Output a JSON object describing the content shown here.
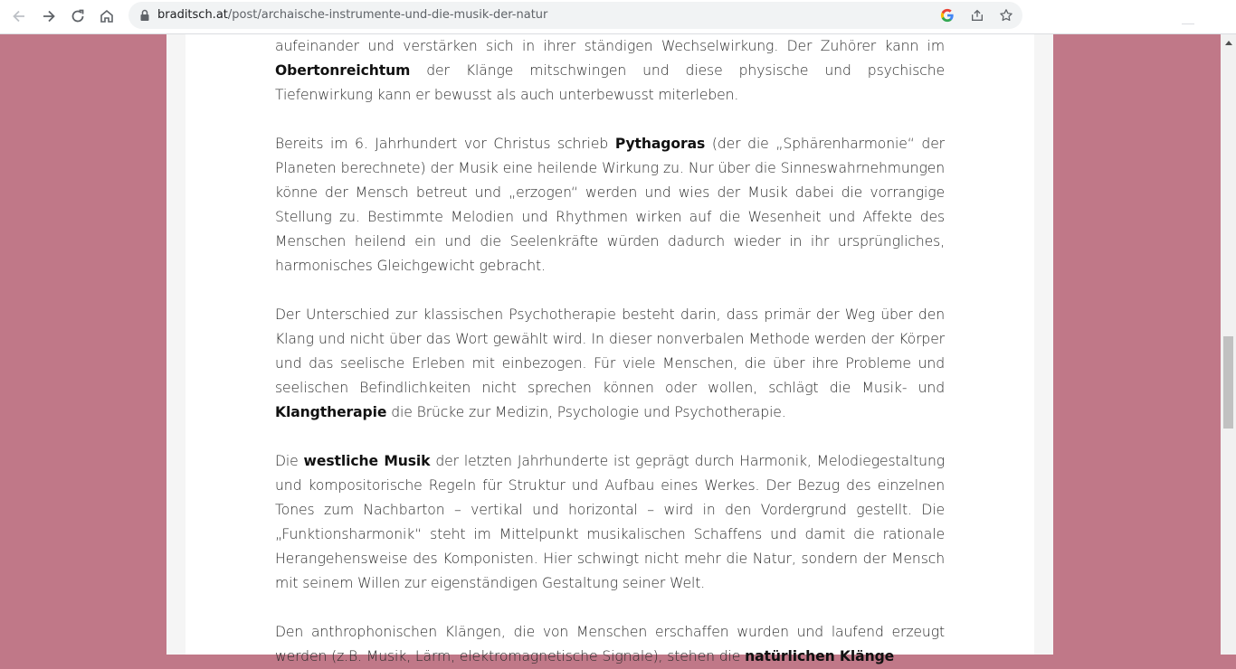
{
  "browser": {
    "url_host": "braditsch.at",
    "url_path": "/post/archaische-instrumente-und-die-musik-der-natur",
    "icons": {
      "back": "arrow-left-icon",
      "forward": "arrow-right-icon",
      "reload": "reload-icon",
      "home": "home-icon",
      "lock": "lock-icon",
      "google": "google-icon",
      "share": "share-icon",
      "bookmark": "star-icon"
    }
  },
  "colors": {
    "background": "#c07888",
    "card": "#ffffff",
    "text": "#2b2b2b"
  },
  "article": {
    "p1": {
      "a": "aufeinander und verstärken sich in ihrer ständigen Wechselwirkung. Der Zuhörer kann im ",
      "b1": "Obertonreichtum",
      "c": " der Klänge mitschwingen und diese physische und psychische Tiefenwirkung kann er bewusst als auch unterbewusst miterleben."
    },
    "p2": {
      "a": "Bereits im 6. Jahrhundert vor Christus schrieb ",
      "b1": "Pythagoras",
      "c": " (der die „Sphärenharmonie“ der Planeten berechnete) der Musik eine heilende Wirkung zu. Nur über die Sinneswahrnehmungen könne der Mensch betreut und „erzogen“ werden und wies der Musik dabei die vorrangige Stellung zu. Bestimmte Melodien und Rhythmen wirken auf die Wesenheit und Affekte des Menschen heilend ein und die Seelenkräfte würden dadurch wieder in ihr ursprüngliches, harmonisches Gleichgewicht gebracht."
    },
    "p3": {
      "a": "Der Unterschied zur klassischen Psychotherapie besteht darin, dass primär der Weg über den Klang und nicht über das Wort gewählt wird. In dieser nonverbalen Methode werden der Körper und das seelische Erleben mit einbezogen. Für viele Menschen, die über ihre Probleme und seelischen Befindlichkeiten nicht sprechen können oder wollen, schlägt die Musik- und ",
      "b1": "Klangtherapie",
      "c": " die Brücke zur Medizin, Psychologie und Psychotherapie."
    },
    "p4": {
      "a": "Die ",
      "b1": "westliche Musik",
      "c": " der letzten Jahrhunderte ist geprägt durch Harmonik, Melodiegestaltung und kompositorische Regeln für Struktur und Aufbau eines Werkes. Der Bezug des einzelnen Tones zum Nachbarton – vertikal und horizontal – wird in den Vordergrund gestellt. Die „Funktionsharmonik“ steht im Mittelpunkt musikalischen Schaffens und damit die rationale Herangehensweise des Komponisten. Hier schwingt nicht mehr die Natur, sondern der Mensch mit seinem Willen zur eigenständigen Gestaltung seiner Welt."
    },
    "p5": {
      "a": "Den anthrophonischen Klängen, die von Menschen erschaffen wurden und laufend erzeugt werden (z.B. Musik, Lärm, elektromagnetische Signale), stehen die ",
      "b1": "natürlichen Klänge"
    }
  }
}
